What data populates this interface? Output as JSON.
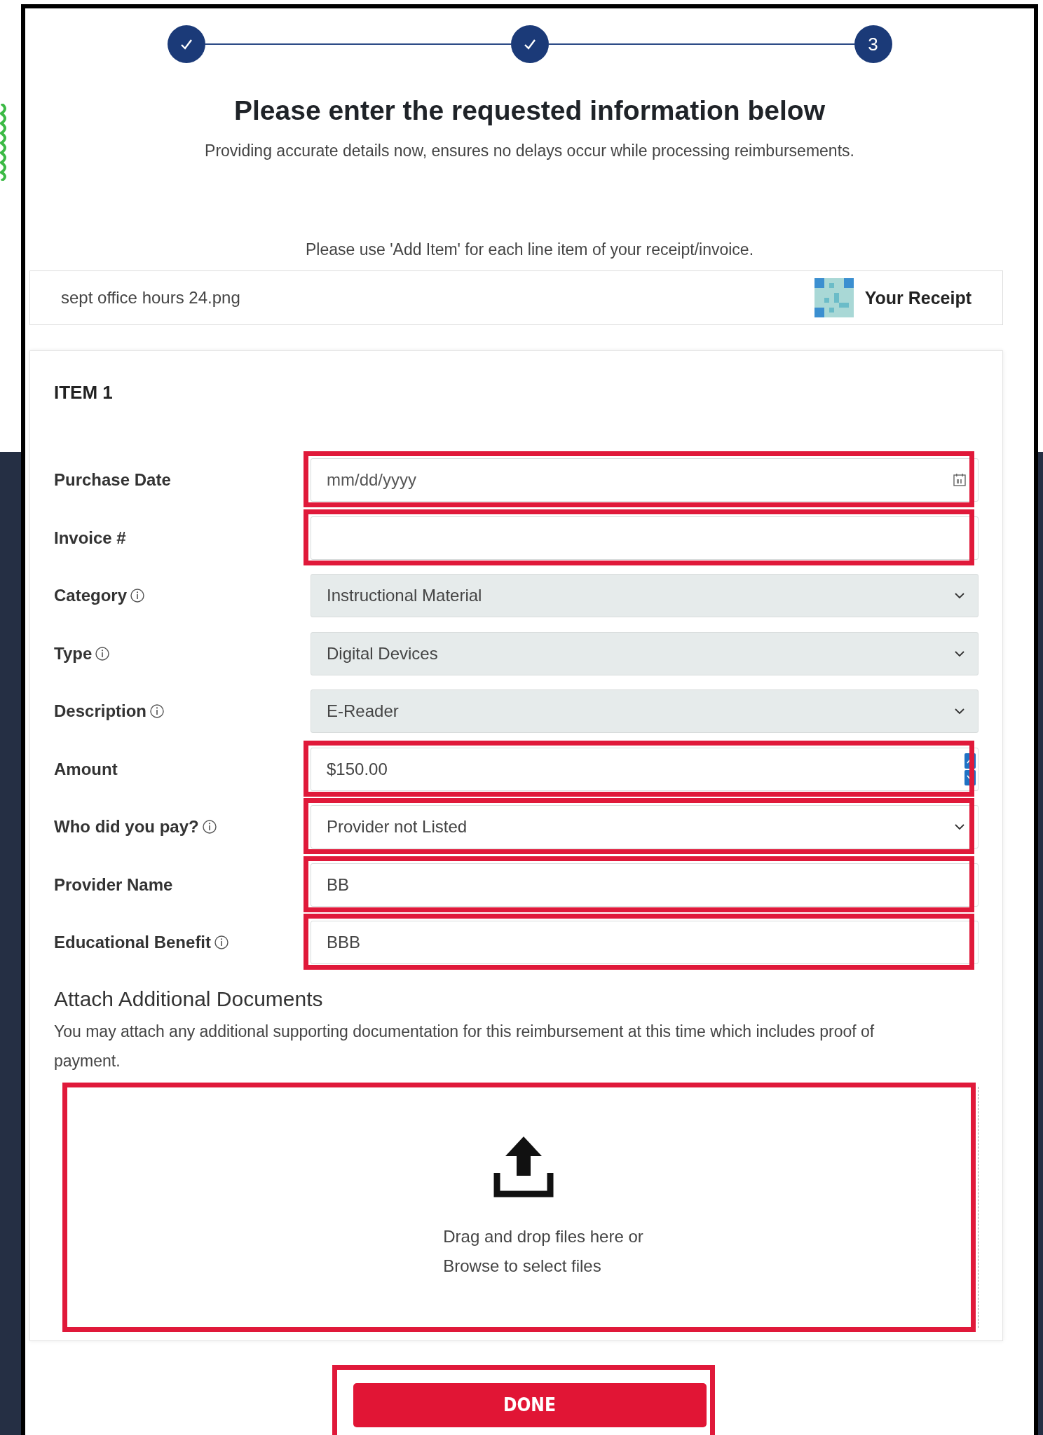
{
  "steps": [
    {
      "completed": true
    },
    {
      "completed": true
    },
    {
      "completed": false,
      "number": "3"
    }
  ],
  "heading": "Please enter the requested information below",
  "subheading": "Providing accurate details now, ensures no delays occur while processing reimbursements.",
  "instruction": "Please use 'Add Item' for each line item of your receipt/invoice.",
  "receipt": {
    "file_name": "sept office hours 24.png",
    "link": "Your Receipt"
  },
  "item": {
    "title": "ITEM 1",
    "fields": [
      {
        "label": "Purchase Date",
        "info": false,
        "kind": "date",
        "placeholder": "mm/dd/yyyy",
        "highlighted": true
      },
      {
        "label": "Invoice #",
        "info": false,
        "kind": "text",
        "highlighted": true
      },
      {
        "label": "Category",
        "info": true,
        "kind": "select",
        "value": "Instructional Material",
        "highlighted": false
      },
      {
        "label": "Type",
        "info": true,
        "kind": "select",
        "value": "Digital Devices",
        "highlighted": false
      },
      {
        "label": "Description",
        "info": true,
        "kind": "select",
        "value": "E-Reader",
        "highlighted": false
      },
      {
        "label": "Amount",
        "info": false,
        "kind": "number",
        "value": "$150.00",
        "highlighted": true
      },
      {
        "label": "Who did you pay?",
        "info": true,
        "kind": "dropdown",
        "value": "Provider not Listed",
        "highlighted": true
      },
      {
        "label": "Provider Name",
        "info": false,
        "kind": "text",
        "value": "BB",
        "highlighted": true
      },
      {
        "label": "Educational Benefit",
        "info": true,
        "kind": "text",
        "value": "BBB",
        "highlighted": true
      }
    ],
    "attach": {
      "title": "Attach Additional Documents",
      "description": "You may attach any additional supporting documentation for this reimbursement at this time which includes proof of payment.",
      "drop_lines": [
        "Drag and drop files here or",
        "Browse to select files"
      ],
      "highlighted": true
    }
  },
  "done_button": {
    "label": "DONE",
    "highlighted": true
  }
}
